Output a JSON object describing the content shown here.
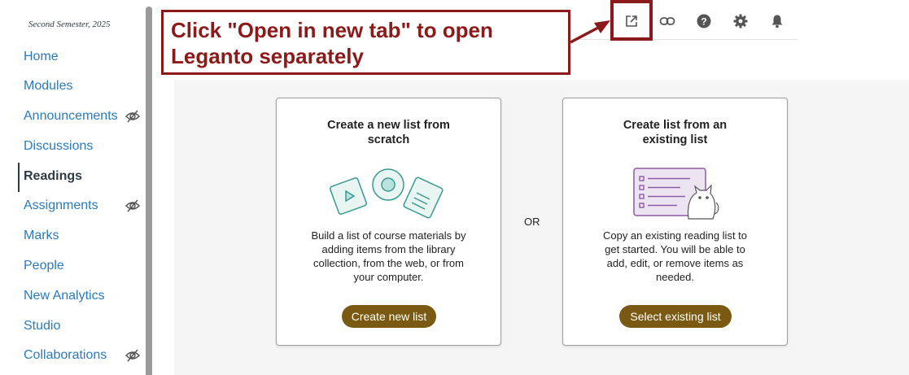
{
  "sidebar": {
    "semester": "Second Semester, 2025",
    "items": [
      {
        "label": "Home"
      },
      {
        "label": "Modules"
      },
      {
        "label": "Announcements"
      },
      {
        "label": "Discussions"
      },
      {
        "label": "Readings"
      },
      {
        "label": "Assignments"
      },
      {
        "label": "Marks"
      },
      {
        "label": "People"
      },
      {
        "label": "New Analytics"
      },
      {
        "label": "Studio"
      },
      {
        "label": "Collaborations"
      }
    ]
  },
  "callout": {
    "line1": "Click \"Open in new tab\" to open",
    "line2": "Leganto separately"
  },
  "toolbar": {
    "icons": [
      "open-in-new-tab-icon",
      "link-icon",
      "help-icon",
      "settings-icon",
      "notifications-icon"
    ],
    "accent": "#8b1a1a"
  },
  "cards": {
    "new": {
      "title_line1": "Create a new list from",
      "title_line2": "scratch",
      "desc_line1": "Build a list of course materials by",
      "desc_line2": "adding items from the library",
      "desc_line3": "collection, from the web, or from",
      "desc_line4": "your computer.",
      "button": "Create new list"
    },
    "existing": {
      "title_line1": "Create list from an",
      "title_line2": "existing list",
      "desc_line1": "Copy an existing reading list to",
      "desc_line2": "get started. You will be able to",
      "desc_line3": "add, edit, or remove items as",
      "desc_line4": "needed.",
      "button": "Select existing list"
    },
    "or_label": "OR",
    "button_color": "#7a5a12"
  }
}
